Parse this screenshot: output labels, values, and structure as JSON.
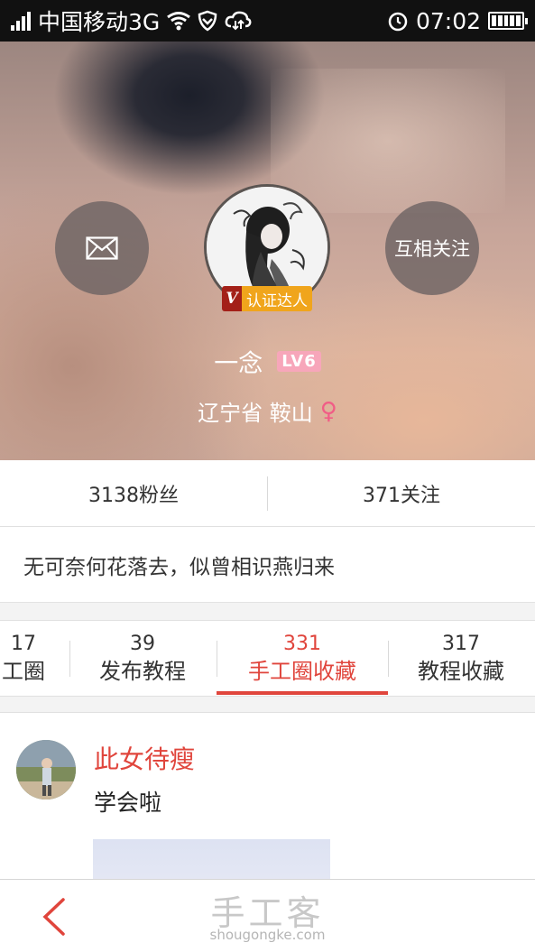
{
  "status_bar": {
    "carrier": "中国移动3G",
    "time": "07:02"
  },
  "profile": {
    "follow_button_label": "互相关注",
    "verified_mark": "V",
    "verified_label": "认证达人",
    "name": "一念",
    "level": "LV6",
    "location": "辽宁省 鞍山",
    "gender_symbol": "♀"
  },
  "stats": {
    "fans": "3138粉丝",
    "following": "371关注"
  },
  "motto": "无可奈何花落去，似曾相识燕归来",
  "tabs": [
    {
      "count": "17",
      "label": "工圈"
    },
    {
      "count": "39",
      "label": "发布教程"
    },
    {
      "count": "331",
      "label": "手工圈收藏"
    },
    {
      "count": "317",
      "label": "教程收藏"
    }
  ],
  "active_tab_index": 2,
  "post": {
    "author": "此女待瘦",
    "text": "学会啦"
  },
  "watermark": {
    "cn": "手工客",
    "en": "shougongke.com"
  },
  "colors": {
    "accent": "#e0453c",
    "level_badge": "#f7a6ba",
    "verified_badge": "#f0a51c"
  }
}
